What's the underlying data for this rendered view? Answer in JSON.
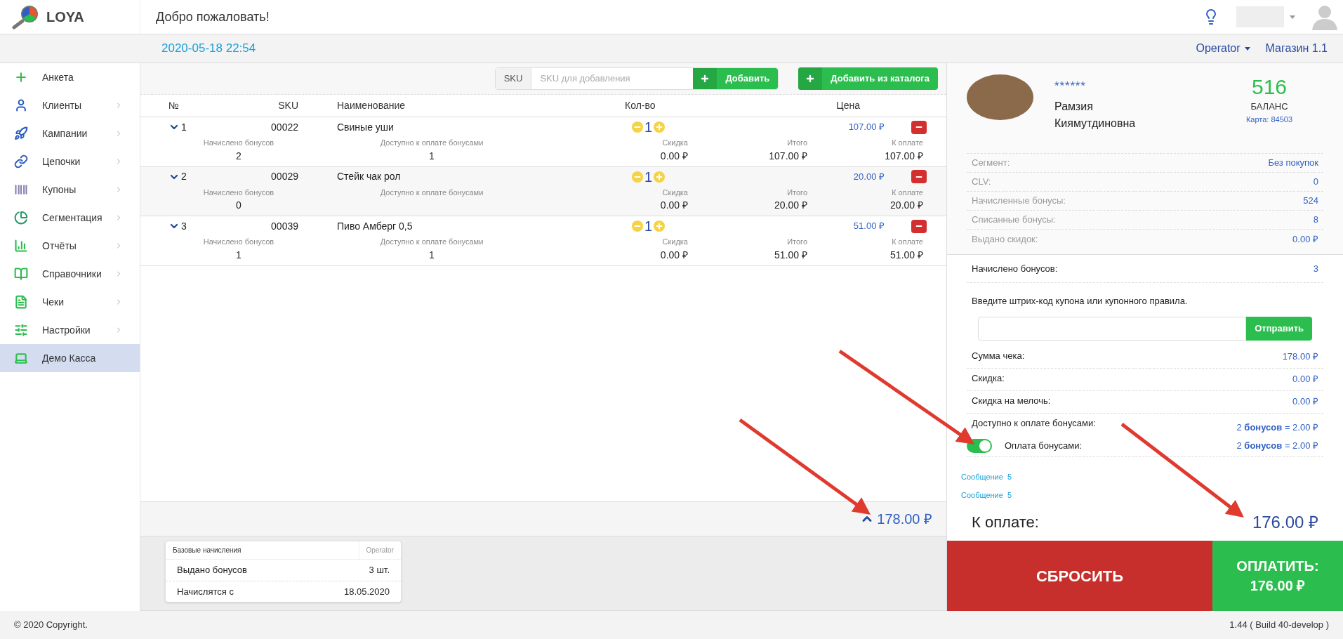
{
  "logo": {
    "text": "LOYA"
  },
  "header": {
    "title": "Добро пожаловать!"
  },
  "subheader": {
    "datetime": "2020-05-18 22:54",
    "operator": "Operator",
    "store": "Магазин 1.1"
  },
  "sidebar": {
    "items": [
      {
        "label": "Анкета",
        "has_submenu": false,
        "selected": false
      },
      {
        "label": "Клиенты",
        "has_submenu": true,
        "selected": false
      },
      {
        "label": "Кампании",
        "has_submenu": true,
        "selected": false
      },
      {
        "label": "Цепочки",
        "has_submenu": true,
        "selected": false
      },
      {
        "label": "Купоны",
        "has_submenu": true,
        "selected": false
      },
      {
        "label": "Сегментация",
        "has_submenu": true,
        "selected": false
      },
      {
        "label": "Отчёты",
        "has_submenu": true,
        "selected": false
      },
      {
        "label": "Справочники",
        "has_submenu": true,
        "selected": false
      },
      {
        "label": "Чеки",
        "has_submenu": true,
        "selected": false
      },
      {
        "label": "Настройки",
        "has_submenu": true,
        "selected": false
      },
      {
        "label": "Демо Касса",
        "has_submenu": false,
        "selected": true
      }
    ]
  },
  "toolbar": {
    "sku_label": "SKU",
    "sku_placeholder": "SKU для добавления",
    "add_button": "Добавить",
    "catalog_button": "Добавить из каталога"
  },
  "table": {
    "columns": [
      "№",
      "SKU",
      "Наименование",
      "Кол-во",
      "Цена"
    ],
    "rows": [
      {
        "number": "1",
        "sku": "00022",
        "name": "Свиные уши",
        "qty": "1",
        "price": "107.00 ₽",
        "expanded": true,
        "details": [
          {
            "label": "Начислено бонусов",
            "value": "2"
          },
          {
            "label": "Доступно к оплате бонусами",
            "value": "1"
          },
          {
            "label": "Скидка",
            "value": "0.00 ₽"
          },
          {
            "label": "Итого",
            "value": "107.00 ₽"
          },
          {
            "label": "К оплате",
            "value": "107.00 ₽"
          }
        ]
      },
      {
        "number": "2",
        "sku": "00029",
        "name": "Стейк чак рол",
        "qty": "1",
        "price": "20.00 ₽",
        "expanded": true,
        "details": [
          {
            "label": "Начислено бонусов",
            "value": "0"
          },
          {
            "label": "Доступно к оплате бонусами"
          },
          {
            "label": "Скидка",
            "value": "0.00 ₽"
          },
          {
            "label": "Итого",
            "value": "20.00 ₽"
          },
          {
            "label": "К оплате",
            "value": "20.00 ₽"
          }
        ]
      },
      {
        "number": "3",
        "sku": "00039",
        "name": "Пиво Амберг 0,5",
        "qty": "1",
        "price": "51.00 ₽",
        "expanded": true,
        "details": [
          {
            "label": "Начислено бонусов",
            "value": "1"
          },
          {
            "label": "Доступно к оплате бонусами",
            "value": "1"
          },
          {
            "label": "Скидка",
            "value": "0.00 ₽"
          },
          {
            "label": "Итого",
            "value": "51.00 ₽"
          },
          {
            "label": "К оплате",
            "value": "51.00 ₽"
          }
        ]
      }
    ]
  },
  "total": {
    "value": "178.00 ₽",
    "expanded": false
  },
  "base_card": {
    "title": "Базовые начисления",
    "operator": "Operator",
    "rows": [
      {
        "label": "Выдано бонусов",
        "value": "3 шт."
      },
      {
        "label": "Начислятся с",
        "value": "18.05.2020"
      }
    ]
  },
  "customer": {
    "masked": "******",
    "name": "Рамзия Киямутдиновна",
    "balance": "516",
    "balance_label": "БАЛАНС",
    "card": "Карта: 84503",
    "info": [
      {
        "label": "Сегмент:",
        "value": "Без покупок"
      },
      {
        "label": "CLV:",
        "value": "0"
      },
      {
        "label": "Начисленные бонусы:",
        "value": "524"
      },
      {
        "label": "Списанные бонусы:",
        "value": "8"
      },
      {
        "label": "Выдано скидок:",
        "value": "0.00 ₽"
      }
    ]
  },
  "accrued": {
    "label": "Начислено бонусов:",
    "value": "3"
  },
  "coupon": {
    "prompt": "Введите штрих-код купона или купонного правила.",
    "button": "Отправить"
  },
  "summary": [
    {
      "label": "Сумма чека:",
      "value": "178.00 ₽"
    },
    {
      "label": "Скидка:",
      "value": "0.00 ₽"
    },
    {
      "label": "Скидка на мелочь:",
      "value": "0.00 ₽"
    },
    {
      "label": "Доступно к оплате бонусами:",
      "value": "2 **бонусов** = 2.00 ₽"
    }
  ],
  "bonus_payment": {
    "label": "Оплата бонусами:",
    "value": "2 **бонусов** = 2.00 ₽",
    "on": true
  },
  "messages": [
    {
      "label": "Сообщение",
      "count": "5"
    },
    {
      "label": "Сообщение",
      "count": "5"
    }
  ],
  "to_pay": {
    "label": "К оплате:",
    "value": "176.00 ₽"
  },
  "reset_button": "СБРОСИТЬ",
  "pay_button": {
    "label": "ОПЛАТИТЬ:",
    "value": "176.00 ₽"
  },
  "footer": {
    "copyright": "© 2020 Copyright.",
    "version": "1.44 ( Build 40-develop )"
  }
}
